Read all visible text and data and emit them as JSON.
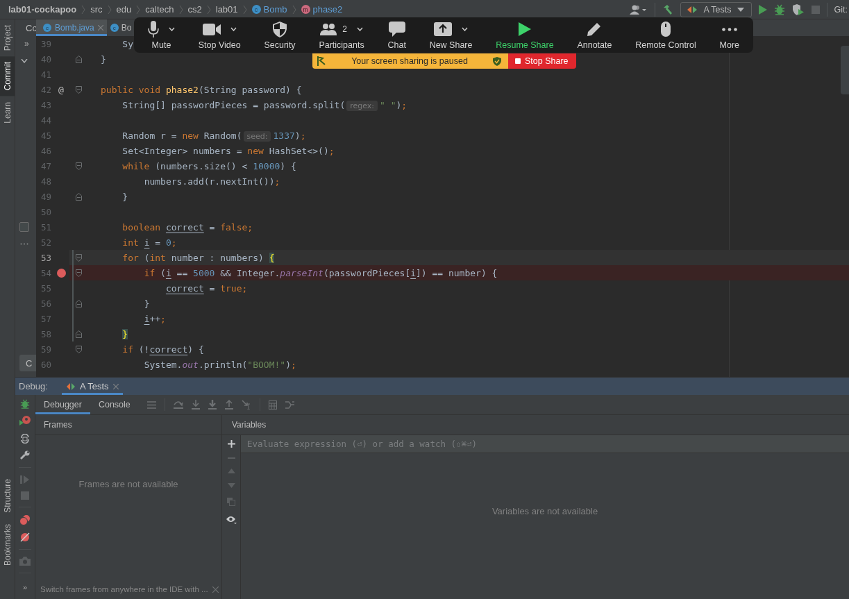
{
  "breadcrumbs": [
    {
      "label": "lab01-cockapoo",
      "kind": "project"
    },
    {
      "label": "src",
      "kind": "folder"
    },
    {
      "label": "edu",
      "kind": "folder"
    },
    {
      "label": "caltech",
      "kind": "folder"
    },
    {
      "label": "cs2",
      "kind": "folder"
    },
    {
      "label": "lab01",
      "kind": "folder"
    },
    {
      "label": "Bomb",
      "kind": "class",
      "icon": "c"
    },
    {
      "label": "phase2",
      "kind": "method",
      "icon": "m"
    }
  ],
  "toolbar": {
    "run_config": "A Tests",
    "vcs_label": "Git:"
  },
  "tool_windows_top": [
    {
      "label": "Project",
      "selected": false
    },
    {
      "label": "Commit",
      "selected": true
    },
    {
      "label": "Learn",
      "selected": false
    }
  ],
  "tool_windows_bottom": [
    {
      "label": "Structure",
      "selected": false
    },
    {
      "label": "Bookmarks",
      "selected": false
    }
  ],
  "commit_panel": {
    "title": "Co",
    "more": "»",
    "checked": false,
    "button": "C"
  },
  "editor": {
    "tabs": [
      {
        "label": "Bomb.java",
        "icon": "c",
        "selected": true
      },
      {
        "label": "Bo",
        "icon": "c",
        "selected": false
      }
    ],
    "lines": [
      {
        "number": "39",
        "breakpoint": false,
        "current": false,
        "changed": false,
        "fold_start": false,
        "fold_end": false,
        "tokens": [
          {
            "kind": "plain",
            "text": "    Sy"
          }
        ]
      },
      {
        "number": "40",
        "breakpoint": false,
        "current": false,
        "changed": false,
        "fold_start": false,
        "fold_end": true,
        "tokens": [
          {
            "kind": "plain",
            "text": "}"
          }
        ]
      },
      {
        "number": "41",
        "breakpoint": false,
        "current": false,
        "changed": false,
        "fold_start": false,
        "fold_end": false
      },
      {
        "number": "42",
        "breakpoint": false,
        "current": false,
        "changed": false,
        "fold_start": true,
        "fold_end": false,
        "marker": "@",
        "tokens": [
          {
            "kind": "keyword",
            "text": "public void "
          },
          {
            "kind": "method",
            "text": "phase2"
          },
          {
            "kind": "plain",
            "text": "(String password) {"
          }
        ]
      },
      {
        "number": "43",
        "breakpoint": false,
        "current": false,
        "changed": false,
        "fold_start": false,
        "fold_end": false,
        "tokens": [
          {
            "kind": "plain",
            "text": "    String[] passwordPieces = password.split("
          },
          {
            "kind": "hint",
            "text": "regex:"
          },
          {
            "kind": "string",
            "text": "\" \""
          },
          {
            "kind": "plain",
            "text": ")"
          },
          {
            "kind": "keyword",
            "text": ";"
          }
        ]
      },
      {
        "number": "44",
        "breakpoint": false,
        "current": false,
        "changed": false,
        "fold_start": false,
        "fold_end": false
      },
      {
        "number": "45",
        "breakpoint": false,
        "current": false,
        "changed": false,
        "fold_start": false,
        "fold_end": false,
        "tokens": [
          {
            "kind": "plain",
            "text": "    Random r = "
          },
          {
            "kind": "keyword",
            "text": "new"
          },
          {
            "kind": "plain",
            "text": " Random("
          },
          {
            "kind": "hint",
            "text": "seed:"
          },
          {
            "kind": "number",
            "text": "1337"
          },
          {
            "kind": "plain",
            "text": ")"
          },
          {
            "kind": "keyword",
            "text": ";"
          }
        ]
      },
      {
        "number": "46",
        "breakpoint": false,
        "current": false,
        "changed": false,
        "fold_start": false,
        "fold_end": false,
        "tokens": [
          {
            "kind": "plain",
            "text": "    Set<Integer> numbers = "
          },
          {
            "kind": "keyword",
            "text": "new"
          },
          {
            "kind": "plain",
            "text": " HashSet<>()"
          },
          {
            "kind": "keyword",
            "text": ";"
          }
        ]
      },
      {
        "number": "47",
        "breakpoint": false,
        "current": false,
        "changed": false,
        "fold_start": true,
        "fold_end": false,
        "tokens": [
          {
            "kind": "keyword",
            "text": "    while"
          },
          {
            "kind": "plain",
            "text": " (numbers.size() < "
          },
          {
            "kind": "number",
            "text": "10000"
          },
          {
            "kind": "plain",
            "text": ") {"
          }
        ]
      },
      {
        "number": "48",
        "breakpoint": false,
        "current": false,
        "changed": false,
        "fold_start": false,
        "fold_end": false,
        "tokens": [
          {
            "kind": "plain",
            "text": "        numbers.add(r.nextInt())"
          },
          {
            "kind": "keyword",
            "text": ";"
          }
        ]
      },
      {
        "number": "49",
        "breakpoint": false,
        "current": false,
        "changed": false,
        "fold_start": false,
        "fold_end": true,
        "tokens": [
          {
            "kind": "plain",
            "text": "    }"
          }
        ]
      },
      {
        "number": "50",
        "breakpoint": false,
        "current": false,
        "changed": false,
        "fold_start": false,
        "fold_end": false
      },
      {
        "number": "51",
        "breakpoint": false,
        "current": false,
        "changed": false,
        "fold_start": false,
        "fold_end": false,
        "tokens": [
          {
            "kind": "keyword",
            "text": "    boolean "
          },
          {
            "kind": "var",
            "text": "correct"
          },
          {
            "kind": "plain",
            "text": " = "
          },
          {
            "kind": "keyword",
            "text": "false;"
          }
        ]
      },
      {
        "number": "52",
        "breakpoint": false,
        "current": false,
        "changed": false,
        "fold_start": false,
        "fold_end": false,
        "tokens": [
          {
            "kind": "keyword",
            "text": "    int "
          },
          {
            "kind": "var",
            "text": "i"
          },
          {
            "kind": "plain",
            "text": " = "
          },
          {
            "kind": "number",
            "text": "0"
          },
          {
            "kind": "keyword",
            "text": ";"
          }
        ]
      },
      {
        "number": "53",
        "breakpoint": false,
        "current": true,
        "changed": true,
        "fold_start": true,
        "fold_end": false,
        "tokens": [
          {
            "kind": "keyword",
            "text": "    for"
          },
          {
            "kind": "plain",
            "text": " ("
          },
          {
            "kind": "keyword",
            "text": "int"
          },
          {
            "kind": "plain",
            "text": " number : numbers) "
          },
          {
            "kind": "brace",
            "text": "{"
          }
        ]
      },
      {
        "number": "54",
        "breakpoint": true,
        "current": false,
        "changed": true,
        "fold_start": true,
        "fold_end": false,
        "tokens": [
          {
            "kind": "keyword",
            "text": "        if"
          },
          {
            "kind": "plain",
            "text": " ("
          },
          {
            "kind": "var",
            "text": "i"
          },
          {
            "kind": "plain",
            "text": " == "
          },
          {
            "kind": "number",
            "text": "5000"
          },
          {
            "kind": "plain",
            "text": " && Integer."
          },
          {
            "kind": "static",
            "text": "parseInt"
          },
          {
            "kind": "plain",
            "text": "(passwordPieces["
          },
          {
            "kind": "var",
            "text": "i"
          },
          {
            "kind": "plain",
            "text": "]) == number) {"
          }
        ]
      },
      {
        "number": "55",
        "breakpoint": false,
        "current": false,
        "changed": true,
        "fold_start": false,
        "fold_end": false,
        "tokens": [
          {
            "kind": "var",
            "text": "            correct"
          },
          {
            "kind": "plain",
            "text": " = "
          },
          {
            "kind": "keyword",
            "text": "true;"
          }
        ]
      },
      {
        "number": "56",
        "breakpoint": false,
        "current": false,
        "changed": true,
        "fold_start": false,
        "fold_end": true,
        "tokens": [
          {
            "kind": "plain",
            "text": "        }"
          }
        ]
      },
      {
        "number": "57",
        "breakpoint": false,
        "current": false,
        "changed": true,
        "fold_start": false,
        "fold_end": false,
        "tokens": [
          {
            "kind": "var",
            "text": "        i"
          },
          {
            "kind": "plain",
            "text": "++"
          },
          {
            "kind": "keyword",
            "text": ";"
          }
        ]
      },
      {
        "number": "58",
        "breakpoint": false,
        "current": false,
        "changed": true,
        "fold_start": false,
        "fold_end": true,
        "tokens": [
          {
            "kind": "brace",
            "text": "    }"
          }
        ]
      },
      {
        "number": "59",
        "breakpoint": false,
        "current": false,
        "changed": false,
        "fold_start": true,
        "fold_end": false,
        "tokens": [
          {
            "kind": "keyword",
            "text": "    if"
          },
          {
            "kind": "plain",
            "text": " (!"
          },
          {
            "kind": "var",
            "text": "correct"
          },
          {
            "kind": "plain",
            "text": ") {"
          }
        ]
      },
      {
        "number": "60",
        "breakpoint": false,
        "current": false,
        "changed": false,
        "fold_start": false,
        "fold_end": false,
        "tokens": [
          {
            "kind": "plain",
            "text": "        System."
          },
          {
            "kind": "static",
            "text": "out"
          },
          {
            "kind": "plain",
            "text": ".println("
          },
          {
            "kind": "string",
            "text": "\"BOOM!\""
          },
          {
            "kind": "plain",
            "text": ")"
          },
          {
            "kind": "keyword",
            "text": ";"
          }
        ]
      }
    ]
  },
  "meeting_toolbar": {
    "items": [
      {
        "label": "Mute",
        "kind": "mic",
        "dropdown": true,
        "active": false
      },
      {
        "label": "Stop Video",
        "kind": "camera",
        "dropdown": true,
        "active": false
      },
      {
        "label": "Security",
        "kind": "shield",
        "dropdown": false,
        "active": false
      },
      {
        "label": "Participants",
        "kind": "people",
        "dropdown": true,
        "active": false,
        "count": "2"
      },
      {
        "label": "Chat",
        "kind": "chat",
        "dropdown": false,
        "active": false
      },
      {
        "label": "New Share",
        "kind": "share",
        "dropdown": true,
        "active": false
      },
      {
        "label": "Resume Share",
        "kind": "play",
        "dropdown": false,
        "active": true
      },
      {
        "label": "Annotate",
        "kind": "pencil",
        "dropdown": false,
        "active": false
      },
      {
        "label": "Remote Control",
        "kind": "mouse",
        "dropdown": false,
        "active": false
      },
      {
        "label": "More",
        "kind": "dots",
        "dropdown": false,
        "active": false
      }
    ]
  },
  "sharing_banner": {
    "message": "Your screen sharing is paused",
    "button": "Stop Share"
  },
  "debug": {
    "title": "Debug:",
    "side_more": "»",
    "tabs": [
      {
        "label": "A Tests",
        "selected": true
      }
    ],
    "subtabs": [
      {
        "label": "Debugger",
        "selected": true
      },
      {
        "label": "Console",
        "selected": false
      }
    ],
    "frames": {
      "header": "Frames",
      "empty": "Frames are not available",
      "hint": "Switch frames from anywhere in the IDE with ..."
    },
    "variables": {
      "header": "Variables",
      "placeholder": "Evaluate expression (⏎) or add a watch (⇧⌘⏎)",
      "empty": "Variables are not available"
    }
  }
}
